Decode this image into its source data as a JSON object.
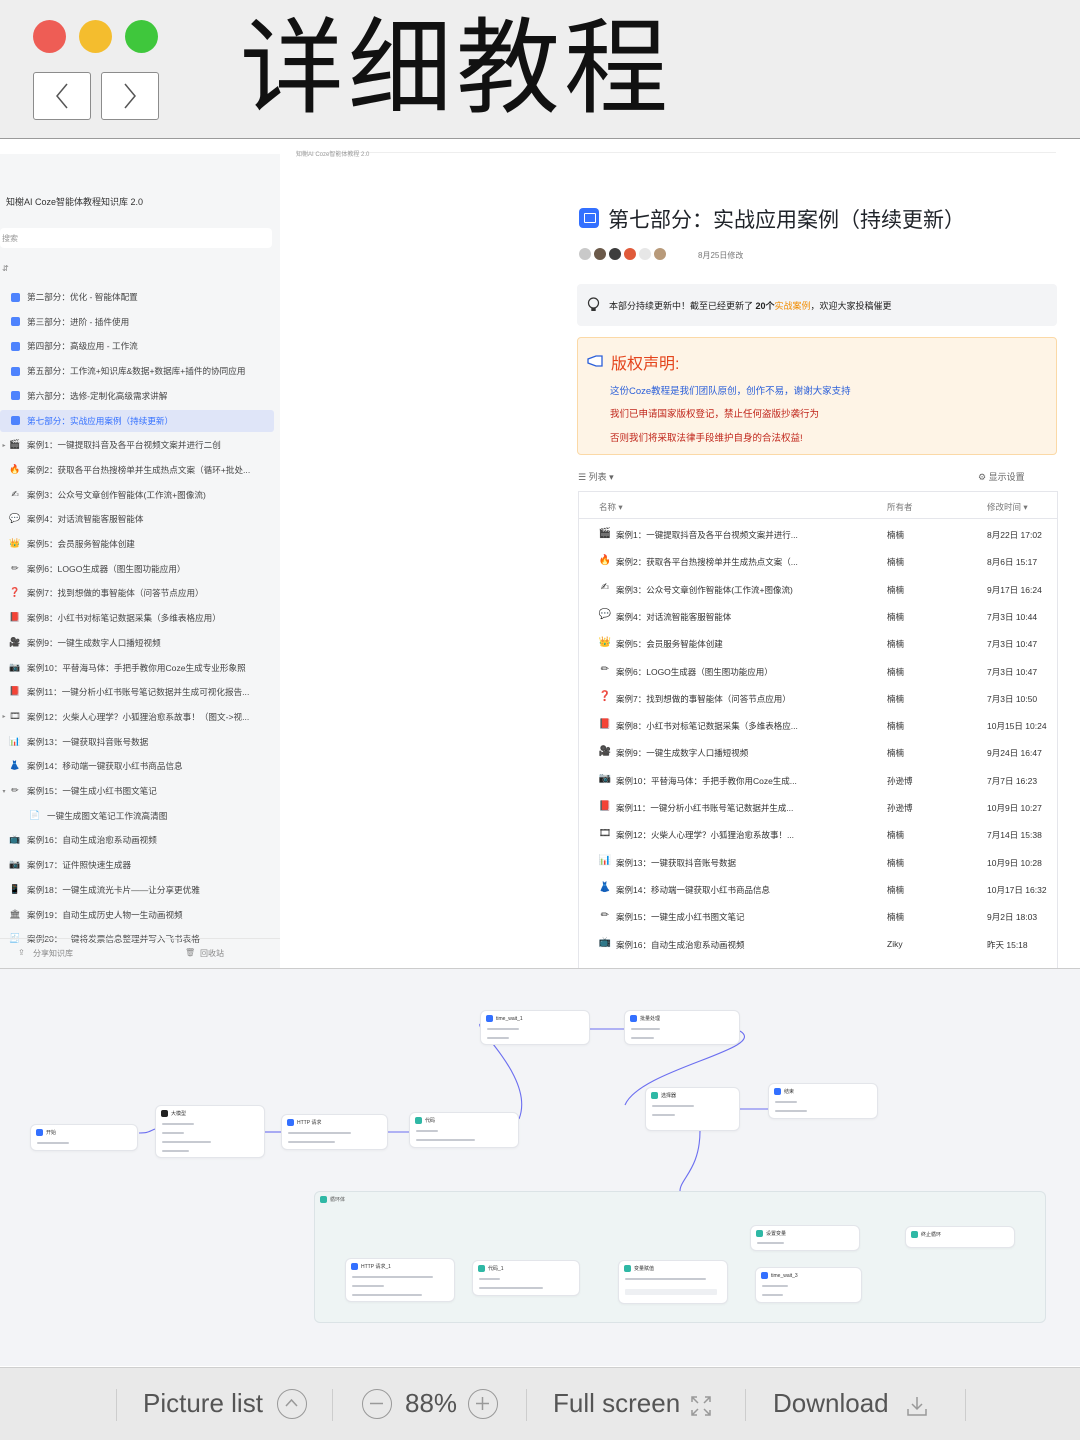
{
  "header": {
    "title": "详细教程"
  },
  "sidebar": {
    "kb_title": "知榭AI Coze智能体教程知识库 2.0",
    "search_placeholder": "搜索",
    "items": [
      {
        "label": "第二部分：优化 - 智能体配置",
        "icon": "part-icon",
        "child": false,
        "caret": ""
      },
      {
        "label": "第三部分：进阶 - 插件使用",
        "icon": "part-icon",
        "child": false,
        "caret": ""
      },
      {
        "label": "第四部分：高级应用 - 工作流",
        "icon": "part-icon",
        "child": false,
        "caret": ""
      },
      {
        "label": "第五部分：工作流+知识库&数据+数据库+插件的协同应用",
        "icon": "part-icon",
        "child": false,
        "caret": ""
      },
      {
        "label": "第六部分：选修-定制化高级需求讲解",
        "icon": "part-icon",
        "child": false,
        "caret": ""
      },
      {
        "label": "第七部分：实战应用案例（持续更新）",
        "icon": "part-icon",
        "child": false,
        "caret": "",
        "active": true
      },
      {
        "label": "案例1：一键提取抖音及各平台视频文案并进行二创",
        "icon": "🎬",
        "child": false,
        "caret": "▸"
      },
      {
        "label": "案例2：获取各平台热搜榜单并生成热点文案（循环+批处...",
        "icon": "🔥",
        "child": false,
        "caret": ""
      },
      {
        "label": "案例3：公众号文章创作智能体(工作流+图像流)",
        "icon": "✍",
        "child": false,
        "caret": ""
      },
      {
        "label": "案例4：对话流智能客服智能体",
        "icon": "💬",
        "child": false,
        "caret": ""
      },
      {
        "label": "案例5：会员服务智能体创建",
        "icon": "👑",
        "child": false,
        "caret": ""
      },
      {
        "label": "案例6：LOGO生成器（图生图功能应用）",
        "icon": "✏",
        "child": false,
        "caret": ""
      },
      {
        "label": "案例7：找到想做的事智能体（问答节点应用）",
        "icon": "❓",
        "child": false,
        "caret": ""
      },
      {
        "label": "案例8：小红书对标笔记数据采集（多维表格应用）",
        "icon": "📕",
        "child": false,
        "caret": ""
      },
      {
        "label": "案例9：一键生成数字人口播短视频",
        "icon": "🎥",
        "child": false,
        "caret": ""
      },
      {
        "label": "案例10：平替海马体：手把手教你用Coze生成专业形象照",
        "icon": "📷",
        "child": false,
        "caret": ""
      },
      {
        "label": "案例11：一键分析小红书账号笔记数据并生成可视化报告...",
        "icon": "📕",
        "child": false,
        "caret": ""
      },
      {
        "label": "案例12：火柴人心理学？小狐狸治愈系故事！（图文->视...",
        "icon": "🎞",
        "child": false,
        "caret": "▸"
      },
      {
        "label": "案例13：一键获取抖音账号数据",
        "icon": "📊",
        "child": false,
        "caret": ""
      },
      {
        "label": "案例14：移动端一键获取小红书商品信息",
        "icon": "👗",
        "child": false,
        "caret": ""
      },
      {
        "label": "案例15：一键生成小红书图文笔记",
        "icon": "✏",
        "child": false,
        "caret": "▾"
      },
      {
        "label": "一键生成图文笔记工作流高清图",
        "icon": "📄",
        "child": true,
        "caret": ""
      },
      {
        "label": "案例16：自动生成治愈系动画视频",
        "icon": "📺",
        "child": false,
        "caret": ""
      },
      {
        "label": "案例17：证件照快速生成器",
        "icon": "📷",
        "child": false,
        "caret": ""
      },
      {
        "label": "案例18：一键生成流光卡片——让分享更优雅",
        "icon": "📱",
        "child": false,
        "caret": ""
      },
      {
        "label": "案例19：自动生成历史人物一生动画视频",
        "icon": "🏛",
        "child": false,
        "caret": ""
      },
      {
        "label": "案例20：一键将发票信息整理并写入飞书表格",
        "icon": "🧾",
        "child": false,
        "caret": ""
      }
    ],
    "footer_share": "分享知识库",
    "footer_bin": "回收站"
  },
  "document": {
    "breadcrumb": "知榭AI Coze智能体教程 2.0",
    "title": "第七部分：实战应用案例（持续更新）",
    "modified": "8月25日修改",
    "callout_prefix": "本部分持续更新中！截至已经更新了 ",
    "callout_count": "20个",
    "callout_highlight": "实战案例",
    "callout_suffix": "，欢迎大家投稿催更",
    "copyright_title": "版权声明:",
    "copyright_lines": [
      "这份Coze教程是我们团队原创，创作不易，谢谢大家支持",
      "我们已申请国家版权登记，禁止任何盗版抄袭行为",
      "否则我们将采取法律手段维护自身的合法权益!"
    ],
    "view_label": "☰ 列表 ▾",
    "display_settings": "显示设置",
    "columns": {
      "name": "名称 ▾",
      "owner": "所有者",
      "modified": "修改时间 ▾"
    },
    "rows": [
      {
        "icon": "🎬",
        "name": "案例1：一键提取抖音及各平台视频文案并进行...",
        "owner": "楠楠",
        "time": "8月22日 17:02"
      },
      {
        "icon": "🔥",
        "name": "案例2：获取各平台热搜榜单并生成热点文案（...",
        "owner": "楠楠",
        "time": "8月6日 15:17"
      },
      {
        "icon": "✍",
        "name": "案例3：公众号文章创作智能体(工作流+图像流)",
        "owner": "楠楠",
        "time": "9月17日 16:24"
      },
      {
        "icon": "💬",
        "name": "案例4：对话流智能客服智能体",
        "owner": "楠楠",
        "time": "7月3日 10:44"
      },
      {
        "icon": "👑",
        "name": "案例5：会员服务智能体创建",
        "owner": "楠楠",
        "time": "7月3日 10:47"
      },
      {
        "icon": "✏",
        "name": "案例6：LOGO生成器（图生图功能应用）",
        "owner": "楠楠",
        "time": "7月3日 10:47"
      },
      {
        "icon": "❓",
        "name": "案例7：找到想做的事智能体（问答节点应用）",
        "owner": "楠楠",
        "time": "7月3日 10:50"
      },
      {
        "icon": "📕",
        "name": "案例8：小红书对标笔记数据采集（多维表格应...",
        "owner": "楠楠",
        "time": "10月15日 10:24"
      },
      {
        "icon": "🎥",
        "name": "案例9：一键生成数字人口播短视频",
        "owner": "楠楠",
        "time": "9月24日 16:47"
      },
      {
        "icon": "📷",
        "name": "案例10：平替海马体：手把手教你用Coze生成...",
        "owner": "孙逊博",
        "time": "7月7日 16:23"
      },
      {
        "icon": "📕",
        "name": "案例11：一键分析小红书账号笔记数据并生成...",
        "owner": "孙逊博",
        "time": "10月9日 10:27"
      },
      {
        "icon": "🎞",
        "name": "案例12：火柴人心理学？小狐狸治愈系故事！...",
        "owner": "楠楠",
        "time": "7月14日 15:38"
      },
      {
        "icon": "📊",
        "name": "案例13：一键获取抖音账号数据",
        "owner": "楠楠",
        "time": "10月9日 10:28"
      },
      {
        "icon": "👗",
        "name": "案例14：移动端一键获取小红书商品信息",
        "owner": "楠楠",
        "time": "10月17日 16:32"
      },
      {
        "icon": "✏",
        "name": "案例15：一键生成小红书图文笔记",
        "owner": "楠楠",
        "time": "9月2日 18:03"
      },
      {
        "icon": "📺",
        "name": "案例16：自动生成治愈系动画视频",
        "owner": "Ziky",
        "time": "昨天 15:18"
      }
    ]
  },
  "workflow": {
    "nodes": {
      "start": "开始",
      "llm": "大模型",
      "http": "HTTP 请求",
      "code": "代码",
      "time_wait": "time_wait_1",
      "batch": "批量处理",
      "selector": "选择器",
      "end": "结束",
      "loop": "循环体",
      "http_inner": "HTTP 请求_1",
      "code_inner": "代码_1",
      "variable": "变量赋值",
      "cond_var": "设置变量",
      "time_wait_inner": "time_wait_3",
      "loop_end": "终止循环"
    },
    "colors": {
      "accent": "#3370ff",
      "loop": "#2fb8a5",
      "edge": "#6b6ef0"
    }
  },
  "toolbar": {
    "picture_list": "Picture list",
    "zoom": "88%",
    "full_screen": "Full screen",
    "download": "Download"
  }
}
